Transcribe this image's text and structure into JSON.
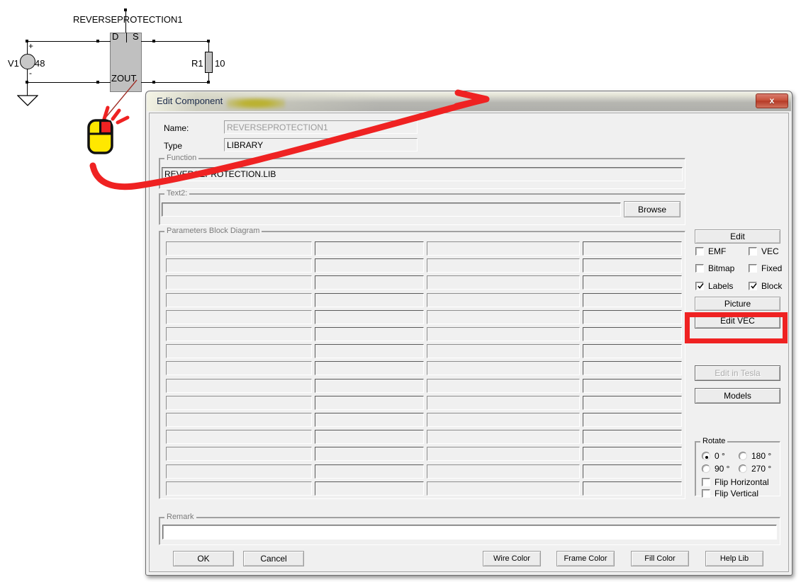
{
  "schematic": {
    "component_label": "REVERSEPROTECTION1",
    "pin_d": "D",
    "pin_s": "S",
    "pin_zout": "ZOUT",
    "source_name": "V1",
    "source_value": "48",
    "plus": "+",
    "minus": "-",
    "resistor_name": "R1",
    "resistor_value": "10"
  },
  "dialog": {
    "title": "Edit Component",
    "close_label": "x",
    "name_label": "Name:",
    "name_value": "REVERSEPROTECTION1",
    "type_label": "Type",
    "type_value": "LIBRARY",
    "function_group": "Function",
    "function_value": "REVERSEPROTECTION.LIB",
    "text2_group": "Text2:",
    "text2_value": "",
    "browse_label": "Browse",
    "params_group": "Parameters Block Diagram",
    "params_rows": 15,
    "params_cols": 4,
    "params_values": [
      [
        "",
        "",
        "",
        ""
      ],
      [
        "",
        "",
        "",
        ""
      ],
      [
        "",
        "",
        "",
        ""
      ],
      [
        "",
        "",
        "",
        ""
      ],
      [
        "",
        "",
        "",
        ""
      ],
      [
        "",
        "",
        "",
        ""
      ],
      [
        "",
        "",
        "",
        ""
      ],
      [
        "",
        "",
        "",
        ""
      ],
      [
        "",
        "",
        "",
        ""
      ],
      [
        "",
        "",
        "",
        ""
      ],
      [
        "",
        "",
        "",
        ""
      ],
      [
        "",
        "",
        "",
        ""
      ],
      [
        "",
        "",
        "",
        ""
      ],
      [
        "",
        "",
        "",
        ""
      ],
      [
        "",
        "",
        "",
        ""
      ]
    ],
    "remark_group": "Remark",
    "remark_value": "",
    "side": {
      "edit_label": "Edit",
      "checkboxes": [
        {
          "label": "EMF",
          "checked": false
        },
        {
          "label": "VEC",
          "checked": false
        },
        {
          "label": "Bitmap",
          "checked": false
        },
        {
          "label": "Fixed",
          "checked": false
        },
        {
          "label": "Labels",
          "checked": true
        },
        {
          "label": "Block",
          "checked": true
        }
      ],
      "picture_label": "Picture",
      "edit_vec_label": "Edit VEC",
      "edit_in_tesla_label": "Edit in Tesla",
      "edit_in_tesla_disabled": true,
      "models_label": "Models"
    },
    "rotate": {
      "group": "Rotate",
      "options": [
        {
          "label": "0 °",
          "selected": true
        },
        {
          "label": "180 °",
          "selected": false
        },
        {
          "label": "90 °",
          "selected": false
        },
        {
          "label": "270 °",
          "selected": false
        }
      ],
      "flip_horizontal": {
        "label": "Flip Horizontal",
        "checked": false
      },
      "flip_vertical": {
        "label": "Flip Vertical",
        "checked": false
      }
    },
    "footer": {
      "ok": "OK",
      "cancel": "Cancel",
      "wire_color": "Wire Color",
      "frame_color": "Frame Color",
      "fill_color": "Fill Color",
      "help_lib": "Help Lib"
    }
  },
  "annotations": {
    "highlight_color": "#ef2222",
    "mouse_icon": "right-click-mouse",
    "highlight_target": "Edit VEC"
  }
}
